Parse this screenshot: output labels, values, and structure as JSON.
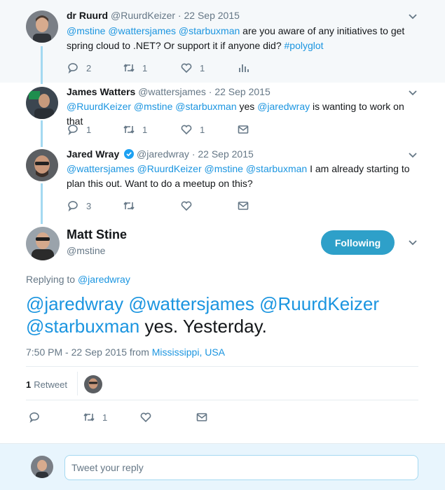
{
  "thread": [
    {
      "name": "dr Ruurd",
      "handle": "@RuurdKeizer",
      "date": "22 Sep 2015",
      "text_line1_parts": [
        "@mstine",
        " ",
        "@wattersjames",
        " ",
        "@starbuxman",
        " are you aware of any initiatives to get"
      ],
      "text_line2_parts": [
        "spring cloud to .NET? Or support it if anyone did? ",
        "#polyglot"
      ],
      "replies": "2",
      "retweets": "1",
      "likes": "1"
    },
    {
      "name": "James Watters",
      "handle": "@wattersjames",
      "date": "22 Sep 2015",
      "text_line1_parts": [
        "@RuurdKeizer",
        " ",
        "@mstine",
        " ",
        "@starbuxman",
        " yes ",
        "@jaredwray",
        " is wanting to work on that"
      ],
      "replies": "1",
      "retweets": "1",
      "likes": "1"
    },
    {
      "name": "Jared Wray",
      "handle": "@jaredwray",
      "date": "22 Sep 2015",
      "text_line1_parts": [
        "@wattersjames",
        " ",
        "@RuurdKeizer",
        " ",
        "@mstine",
        " ",
        "@starbuxman",
        " I am already starting to"
      ],
      "text_line2": "plan this out. Want to do a meetup on this?",
      "replies": "3"
    }
  ],
  "separator_dot": "·",
  "main": {
    "name": "Matt Stine",
    "handle": "@mstine",
    "follow_label": "Following",
    "replying_prefix": "Replying to",
    "replying_to": "@jaredwray",
    "text_line1_parts": [
      "@jaredwray",
      " ",
      "@wattersjames",
      " ",
      "@RuurdKeizer"
    ],
    "text_line2_parts": [
      "@starbuxman",
      " yes. Yesterday."
    ],
    "timestamp": "7:50 PM - 22 Sep 2015 from",
    "location": "Mississippi, USA",
    "retweet_count": "1",
    "retweet_label": "Retweet",
    "action_retweets": "1"
  },
  "reply_bar": {
    "placeholder": "Tweet your reply"
  },
  "colors": {
    "link": "#1b95e0",
    "thread_line": "#a4d9f1",
    "follow_button": "#2ea0c9",
    "muted": "#657786"
  }
}
